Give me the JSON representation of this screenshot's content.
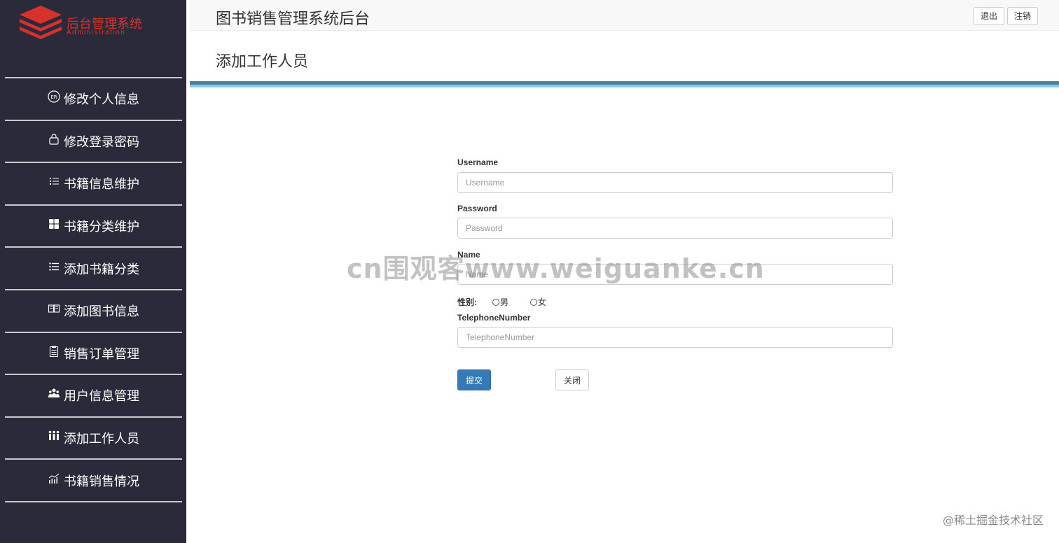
{
  "logo": {
    "title": "后台管理系统",
    "subtitle": "Administration"
  },
  "sidebar": {
    "items": [
      {
        "label": "修改个人信息",
        "icon": "id-card-icon"
      },
      {
        "label": "修改登录密码",
        "icon": "lock-icon"
      },
      {
        "label": "书籍信息维护",
        "icon": "list-icon"
      },
      {
        "label": "书籍分类维护",
        "icon": "grid-icon"
      },
      {
        "label": "添加书籍分类",
        "icon": "list-bullets-icon"
      },
      {
        "label": "添加图书信息",
        "icon": "book-open-icon"
      },
      {
        "label": "销售订单管理",
        "icon": "clipboard-icon"
      },
      {
        "label": "用户信息管理",
        "icon": "users-icon"
      },
      {
        "label": "添加工作人员",
        "icon": "staff-icon"
      },
      {
        "label": "书籍销售情况",
        "icon": "chart-icon"
      }
    ]
  },
  "header": {
    "title": "图书销售管理系统后台",
    "logout_label": "退出",
    "cancel_label": "注销"
  },
  "page": {
    "title": "添加工作人员"
  },
  "form": {
    "username_label": "Username",
    "username_placeholder": "Username",
    "password_label": "Password",
    "password_placeholder": "Password",
    "name_label": "Name",
    "name_placeholder": "Name",
    "gender_label": "性别:",
    "gender_male": "男",
    "gender_female": "女",
    "phone_label": "TelephoneNumber",
    "phone_placeholder": "TelephoneNumber",
    "submit_label": "提交",
    "close_label": "关闭"
  },
  "watermarks": {
    "center": "cn围观客www.weiguanke.cn",
    "corner": "@稀土掘金技术社区"
  },
  "colors": {
    "sidebar_bg": "#2b2a3a",
    "brand_red": "#d8312c",
    "primary": "#337ab7",
    "rule_dark": "#4a7fa6",
    "rule_light": "#8fc7dd"
  }
}
